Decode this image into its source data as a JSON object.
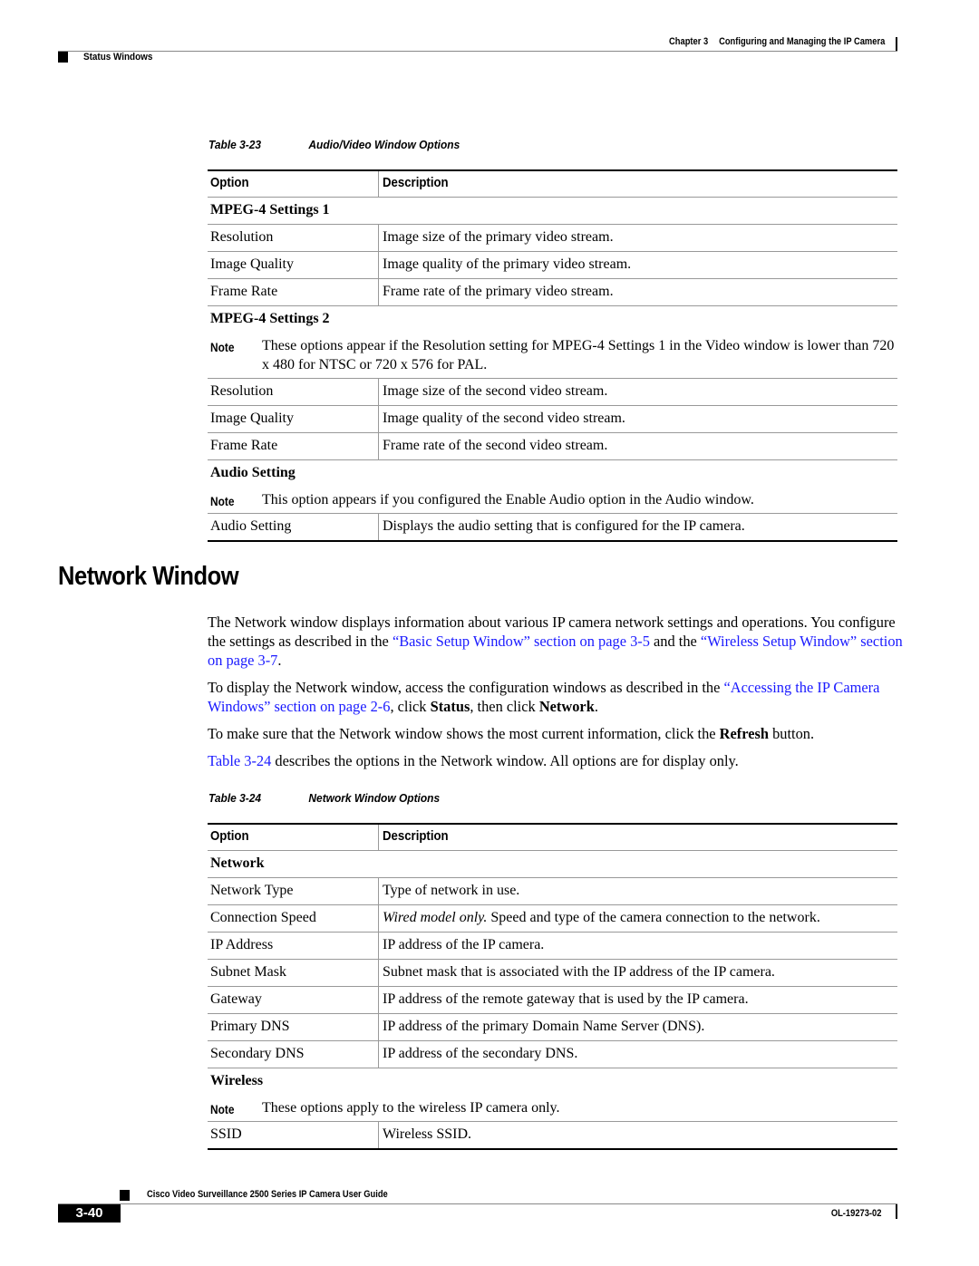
{
  "header": {
    "chapter_label": "Chapter 3",
    "chapter_title": "Configuring and Managing the IP Camera",
    "section": "Status Windows"
  },
  "table1": {
    "caption_num": "Table 3-23",
    "caption_title": "Audio/Video Window Options",
    "col_option": "Option",
    "col_description": "Description",
    "groups": [
      {
        "title": "MPEG-4 Settings 1",
        "rows": [
          {
            "option": "Resolution",
            "description": "Image size of the primary video stream."
          },
          {
            "option": "Image Quality",
            "description": "Image quality of the primary video stream."
          },
          {
            "option": "Frame Rate",
            "description": "Frame rate of the primary video stream."
          }
        ]
      },
      {
        "title": "MPEG-4 Settings 2",
        "note_label": "Note",
        "note": "These options appear if the Resolution setting for MPEG-4 Settings 1 in the Video window is lower than 720 x 480 for NTSC or 720 x 576 for PAL.",
        "rows": [
          {
            "option": "Resolution",
            "description": "Image size of the second video stream."
          },
          {
            "option": "Image Quality",
            "description": "Image quality of the second video stream."
          },
          {
            "option": "Frame Rate",
            "description": "Frame rate of the second video stream."
          }
        ]
      },
      {
        "title": "Audio Setting",
        "note_label": "Note",
        "note": "This option appears if you configured the Enable Audio option in the Audio window.",
        "rows": [
          {
            "option": "Audio Setting",
            "description": "Displays the audio setting that is configured for the IP camera."
          }
        ]
      }
    ]
  },
  "section": {
    "title": "Network Window",
    "p1_a": "The Network window displays information about various IP camera network settings and operations. You configure the settings as described in the ",
    "p1_link1": "“Basic Setup Window” section on page 3-5",
    "p1_b": " and the ",
    "p1_link2": "“Wireless Setup Window” section on page 3-7",
    "p1_c": ".",
    "p2_a": "To display the Network window, access the configuration windows as described in the ",
    "p2_link": "“Accessing the IP Camera Windows” section on page 2-6",
    "p2_b": ", click ",
    "p2_bold1": "Status",
    "p2_c": ", then click ",
    "p2_bold2": "Network",
    "p2_d": ".",
    "p3_a": "To make sure that the Network window shows the most current information, click the ",
    "p3_bold": "Refresh",
    "p3_b": " button.",
    "p4_link": "Table 3-24",
    "p4_a": " describes the options in the Network window. All options are for display only."
  },
  "table2": {
    "caption_num": "Table 3-24",
    "caption_title": "Network Window Options",
    "col_option": "Option",
    "col_description": "Description",
    "group1_title": "Network",
    "network_rows": [
      {
        "option": "Network Type",
        "description": "Type of network in use."
      },
      {
        "option": "Connection Speed",
        "description_italic": "Wired model only.",
        "description": " Speed and type of the camera connection to the network."
      },
      {
        "option": "IP Address",
        "description": "IP address of the IP camera."
      },
      {
        "option": "Subnet Mask",
        "description": "Subnet mask that is associated with the IP address of the IP camera."
      },
      {
        "option": "Gateway",
        "description": "IP address of the remote gateway that is used by the IP camera."
      },
      {
        "option": "Primary DNS",
        "description": "IP address of the primary Domain Name Server (DNS)."
      },
      {
        "option": "Secondary DNS",
        "description": "IP address of the secondary DNS."
      }
    ],
    "group2_title": "Wireless",
    "group2_note_label": "Note",
    "group2_note": "These options apply to the wireless IP camera only.",
    "wireless_rows": [
      {
        "option": "SSID",
        "description": "Wireless SSID."
      }
    ]
  },
  "footer": {
    "guide_title": "Cisco Video Surveillance 2500 Series IP Camera User Guide",
    "page_number": "3-40",
    "doc_number": "OL-19273-02"
  }
}
